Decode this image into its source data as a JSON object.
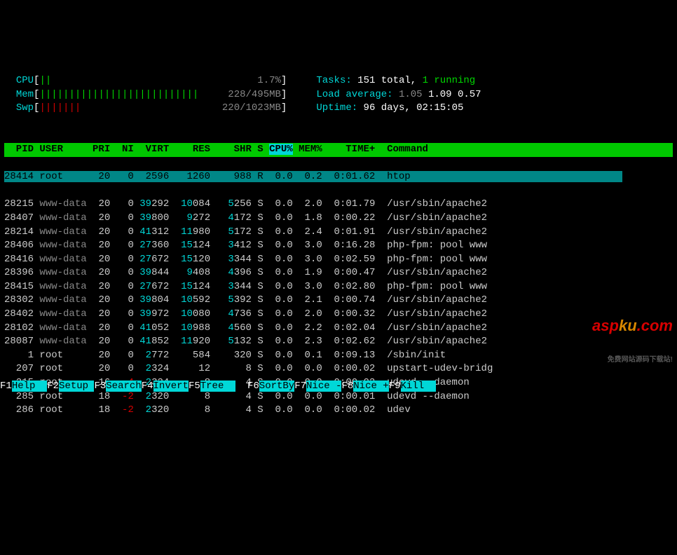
{
  "meters": {
    "cpu": {
      "label": "CPU",
      "bar": "||",
      "pct": "1.7%"
    },
    "mem": {
      "label": "Mem",
      "bar": "|||||||||||||||||||||||||||",
      "used": "228/495MB"
    },
    "swp": {
      "label": "Swp",
      "bar": "|||||||",
      "used": "220/1023MB"
    }
  },
  "stats": {
    "tasks_label": "Tasks:",
    "tasks_total": "151 total,",
    "tasks_running": "1 running",
    "load_label": "Load average:",
    "load1": "1.05",
    "load2": "1.09",
    "load3": "0.57",
    "uptime_label": "Uptime:",
    "uptime_val": "96 days, 02:15:05"
  },
  "columns": [
    "PID",
    "USER",
    "PRI",
    "NI",
    "VIRT",
    "RES",
    "SHR",
    "S",
    "CPU%",
    "MEM%",
    "TIME+",
    "Command"
  ],
  "selected": {
    "pid": "28414",
    "user": "root",
    "pri": "20",
    "ni": "0",
    "virt": "2596",
    "res": "1260",
    "shr": "988",
    "s": "R",
    "cpu": "0.0",
    "mem": "0.2",
    "time": "0:01.62",
    "cmd": "htop"
  },
  "rows": [
    {
      "pid": "28215",
      "user": "www-data",
      "pri": "20",
      "ni": "0",
      "virt_hi": "39",
      "virt": "292",
      "res_hi": "10",
      "res": "084",
      "shr_hi": "5",
      "shr": "256",
      "s": "S",
      "cpu": "0.0",
      "mem": "2.0",
      "time": "0:01.79",
      "cmd": "/usr/sbin/apache2"
    },
    {
      "pid": "28407",
      "user": "www-data",
      "pri": "20",
      "ni": "0",
      "virt_hi": "39",
      "virt": "800",
      "res_hi": "9",
      "res": "272",
      "shr_hi": "4",
      "shr": "172",
      "s": "S",
      "cpu": "0.0",
      "mem": "1.8",
      "time": "0:00.22",
      "cmd": "/usr/sbin/apache2"
    },
    {
      "pid": "28214",
      "user": "www-data",
      "pri": "20",
      "ni": "0",
      "virt_hi": "41",
      "virt": "312",
      "res_hi": "11",
      "res": "980",
      "shr_hi": "5",
      "shr": "172",
      "s": "S",
      "cpu": "0.0",
      "mem": "2.4",
      "time": "0:01.91",
      "cmd": "/usr/sbin/apache2"
    },
    {
      "pid": "28406",
      "user": "www-data",
      "pri": "20",
      "ni": "0",
      "virt_hi": "27",
      "virt": "360",
      "res_hi": "15",
      "res": "124",
      "shr_hi": "3",
      "shr": "412",
      "s": "S",
      "cpu": "0.0",
      "mem": "3.0",
      "time": "0:16.28",
      "cmd": "php-fpm: pool www"
    },
    {
      "pid": "28416",
      "user": "www-data",
      "pri": "20",
      "ni": "0",
      "virt_hi": "27",
      "virt": "672",
      "res_hi": "15",
      "res": "120",
      "shr_hi": "3",
      "shr": "344",
      "s": "S",
      "cpu": "0.0",
      "mem": "3.0",
      "time": "0:02.59",
      "cmd": "php-fpm: pool www"
    },
    {
      "pid": "28396",
      "user": "www-data",
      "pri": "20",
      "ni": "0",
      "virt_hi": "39",
      "virt": "844",
      "res_hi": "9",
      "res": "408",
      "shr_hi": "4",
      "shr": "396",
      "s": "S",
      "cpu": "0.0",
      "mem": "1.9",
      "time": "0:00.47",
      "cmd": "/usr/sbin/apache2"
    },
    {
      "pid": "28415",
      "user": "www-data",
      "pri": "20",
      "ni": "0",
      "virt_hi": "27",
      "virt": "672",
      "res_hi": "15",
      "res": "124",
      "shr_hi": "3",
      "shr": "344",
      "s": "S",
      "cpu": "0.0",
      "mem": "3.0",
      "time": "0:02.80",
      "cmd": "php-fpm: pool www"
    },
    {
      "pid": "28302",
      "user": "www-data",
      "pri": "20",
      "ni": "0",
      "virt_hi": "39",
      "virt": "804",
      "res_hi": "10",
      "res": "592",
      "shr_hi": "5",
      "shr": "392",
      "s": "S",
      "cpu": "0.0",
      "mem": "2.1",
      "time": "0:00.74",
      "cmd": "/usr/sbin/apache2"
    },
    {
      "pid": "28402",
      "user": "www-data",
      "pri": "20",
      "ni": "0",
      "virt_hi": "39",
      "virt": "972",
      "res_hi": "10",
      "res": "080",
      "shr_hi": "4",
      "shr": "736",
      "s": "S",
      "cpu": "0.0",
      "mem": "2.0",
      "time": "0:00.32",
      "cmd": "/usr/sbin/apache2"
    },
    {
      "pid": "28102",
      "user": "www-data",
      "pri": "20",
      "ni": "0",
      "virt_hi": "41",
      "virt": "052",
      "res_hi": "10",
      "res": "988",
      "shr_hi": "4",
      "shr": "560",
      "s": "S",
      "cpu": "0.0",
      "mem": "2.2",
      "time": "0:02.04",
      "cmd": "/usr/sbin/apache2"
    },
    {
      "pid": "28087",
      "user": "www-data",
      "pri": "20",
      "ni": "0",
      "virt_hi": "41",
      "virt": "852",
      "res_hi": "11",
      "res": "920",
      "shr_hi": "5",
      "shr": "132",
      "s": "S",
      "cpu": "0.0",
      "mem": "2.3",
      "time": "0:02.62",
      "cmd": "/usr/sbin/apache2"
    },
    {
      "pid": "1",
      "user": "root",
      "pri": "20",
      "ni": "0",
      "virt_hi": "2",
      "virt": "772",
      "res_hi": "",
      "res": "584",
      "shr_hi": "",
      "shr": "320",
      "s": "S",
      "cpu": "0.0",
      "mem": "0.1",
      "time": "0:09.13",
      "cmd": "/sbin/init"
    },
    {
      "pid": "207",
      "user": "root",
      "pri": "20",
      "ni": "0",
      "virt_hi": "2",
      "virt": "324",
      "res_hi": "",
      "res": "12",
      "shr_hi": "",
      "shr": "8",
      "s": "S",
      "cpu": "0.0",
      "mem": "0.0",
      "time": "0:00.02",
      "cmd": "upstart-udev-bridg"
    },
    {
      "pid": "215",
      "user": "root",
      "pri": "16",
      "ni": "-4",
      "nired": true,
      "virt_hi": "2",
      "virt": "324",
      "res_hi": "",
      "res": "8",
      "shr_hi": "",
      "shr": "4",
      "s": "S",
      "cpu": "0.0",
      "mem": "0.0",
      "time": "0:00.02",
      "cmd": "udevd --daemon"
    },
    {
      "pid": "285",
      "user": "root",
      "pri": "18",
      "ni": "-2",
      "nired": true,
      "virt_hi": "2",
      "virt": "320",
      "res_hi": "",
      "res": "8",
      "shr_hi": "",
      "shr": "4",
      "s": "S",
      "cpu": "0.0",
      "mem": "0.0",
      "time": "0:00.01",
      "cmd": "udevd --daemon"
    },
    {
      "pid": "286",
      "user": "root",
      "pri": "18",
      "ni": "-2",
      "nired": true,
      "virt_hi": "2",
      "virt": "320",
      "res_hi": "",
      "res": "8",
      "shr_hi": "",
      "shr": "4",
      "s": "S",
      "cpu": "0.0",
      "mem": "0.0",
      "time": "0:00.02",
      "cmd": "udev"
    }
  ],
  "footer": [
    {
      "key": "F1",
      "label": "Help  "
    },
    {
      "key": "F2",
      "label": "Setup "
    },
    {
      "key": "F3",
      "label": "Search"
    },
    {
      "key": "F4",
      "label": "Invert"
    },
    {
      "key": "F5",
      "label": "Tree  "
    },
    {
      "key": "F6",
      "label": "SortBy"
    },
    {
      "key": "F7",
      "label": "Nice -"
    },
    {
      "key": "F8",
      "label": "Nice +"
    },
    {
      "key": "F9",
      "label": "Kill  "
    }
  ],
  "watermark": {
    "a": "asp",
    "b": "ku",
    "c": ".com",
    "sub": "免费网站源码下载站!"
  }
}
